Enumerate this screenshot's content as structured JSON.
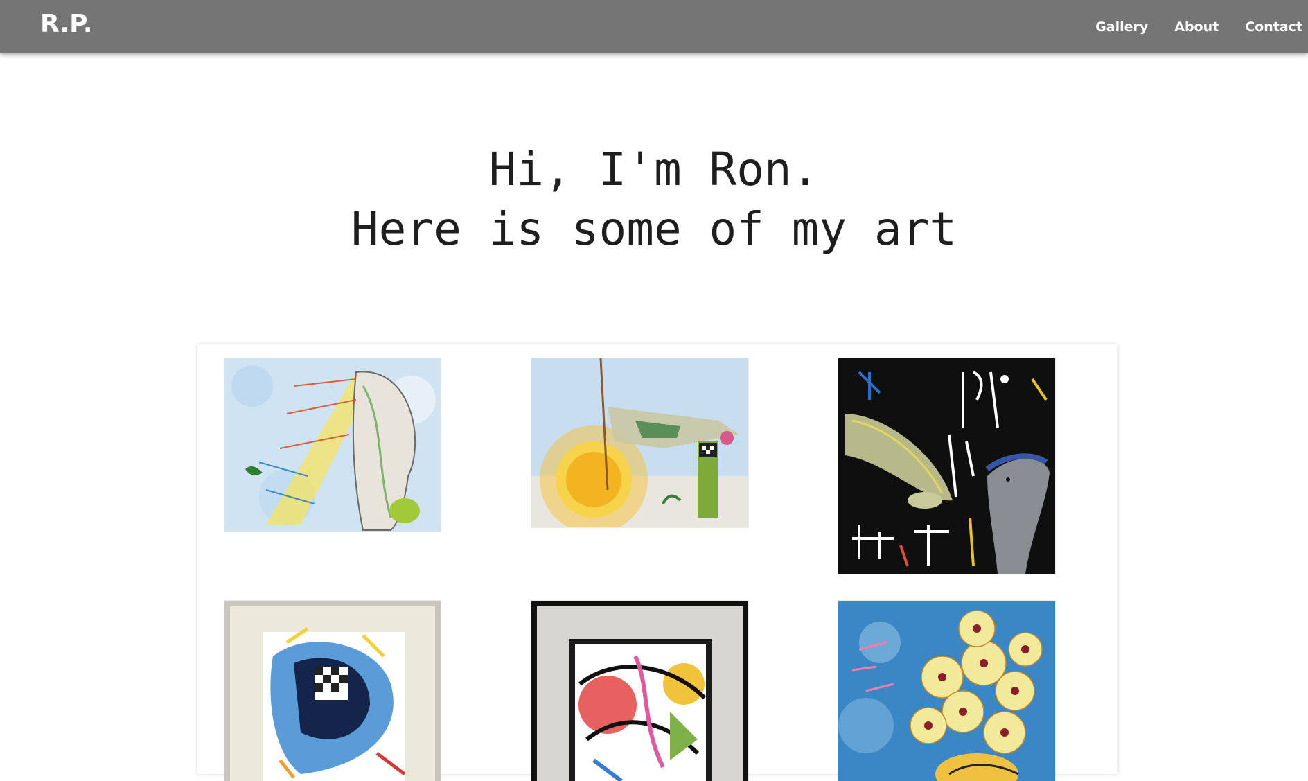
{
  "brand": "R.P.",
  "nav": {
    "gallery": "Gallery",
    "about": "About",
    "contact": "Contact"
  },
  "hero": {
    "line1": "Hi, I'm Ron.",
    "line2": "Here is some of my art"
  },
  "colors": {
    "navbar": "#757575",
    "nav_text": "#ffffff",
    "hero_text": "#1e1e1e",
    "page_bg": "#ffffff"
  },
  "gallery": {
    "items": [
      {
        "name": "artwork-feathered-profile"
      },
      {
        "name": "artwork-sun-orb"
      },
      {
        "name": "artwork-dolphins-script"
      },
      {
        "name": "artwork-framed-abstract-blue"
      },
      {
        "name": "artwork-framed-abstract-black"
      },
      {
        "name": "artwork-yellow-flowers"
      }
    ]
  }
}
